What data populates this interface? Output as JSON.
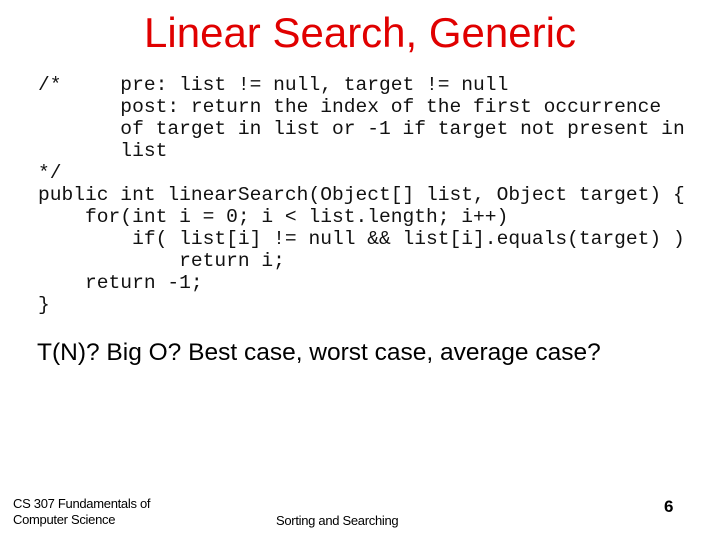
{
  "slide": {
    "title": "Linear Search, Generic",
    "code_lines": [
      "/*     pre: list != null, target != null",
      "       post: return the index of the first occurrence",
      "       of target in list or -1 if target not present in",
      "       list",
      "*/",
      "public int linearSearch(Object[] list, Object target) {",
      "    for(int i = 0; i < list.length; i++)",
      "        if( list[i] != null && list[i].equals(target) )",
      "            return i;",
      "    return -1;",
      "}"
    ],
    "question": "T(N)? Big O? Best case, worst case, average case?"
  },
  "footer": {
    "course_line1": "CS 307 Fundamentals of",
    "course_line2": "Computer Science",
    "topic": "Sorting and Searching",
    "page_number": "6"
  }
}
